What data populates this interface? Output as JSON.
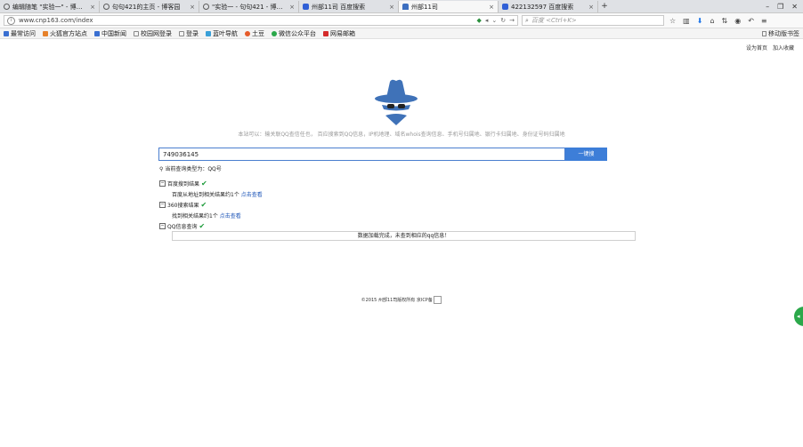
{
  "tabs": [
    {
      "title": "编辑随笔 \"实验一\" - 博客园",
      "active": false,
      "fav_color": "#5a5a5a"
    },
    {
      "title": "句句421的主页 - 博客园",
      "active": false,
      "fav_color": "#5a5a5a"
    },
    {
      "title": "\"实验一 - 句句421 - 博客园",
      "active": false,
      "fav_color": "#5a5a5a"
    },
    {
      "title": "州部11司 百度搜索",
      "active": false,
      "fav_color": "#2f5fd6"
    },
    {
      "title": "州部11司",
      "active": true,
      "fav_color": "#3d6fc0"
    },
    {
      "title": "422132597 百度搜索",
      "active": false,
      "fav_color": "#2f5fd6"
    }
  ],
  "url": "www.cnp163.com/index",
  "search_placeholder": "百度 <Ctrl+K>",
  "bookmarks": [
    {
      "label": "最常访问",
      "color": "#3a6fd1"
    },
    {
      "label": "火狐官方站点",
      "color": "#e6812a"
    },
    {
      "label": "中国新闻",
      "color": "#3a6fd1"
    },
    {
      "label": "校园网登录",
      "color": "#888888"
    },
    {
      "label": "登录",
      "color": "#888888"
    },
    {
      "label": "蓝叶导航",
      "color": "#3aa0d8"
    },
    {
      "label": "土豆",
      "color": "#e65c2a"
    },
    {
      "label": "微信公众平台",
      "color": "#2aa84a"
    },
    {
      "label": "网易邮箱",
      "color": "#d42a2a"
    }
  ],
  "mobile_bookmarks": "移动版书签",
  "toplinks": {
    "homepage": "设为首页",
    "favorite": "加入收藏"
  },
  "intro": "本站可以：输关联QQ查信任也， 百应搜索到QQ信息，IP机地理、域名whois查询信息、手机号归属地、银行卡归属地、身份证号码归属地",
  "query": {
    "value": "749036145",
    "button": "一键搜"
  },
  "query_type": "当前查询类型为：QQ号",
  "sections": [
    {
      "title": "百度搜到结果",
      "detail": "百度从地址到相关结果约1个",
      "link": "点击查看"
    },
    {
      "title": "360搜索结果",
      "detail": "找到相关结果约1个",
      "link": "点击查看"
    },
    {
      "title": "QQ信息查询",
      "detail": "",
      "link": ""
    }
  ],
  "result_message": "数据加载完成，未查到相应的qq信息！",
  "footer": "©2015 州部11司版权所有 京ICP备"
}
